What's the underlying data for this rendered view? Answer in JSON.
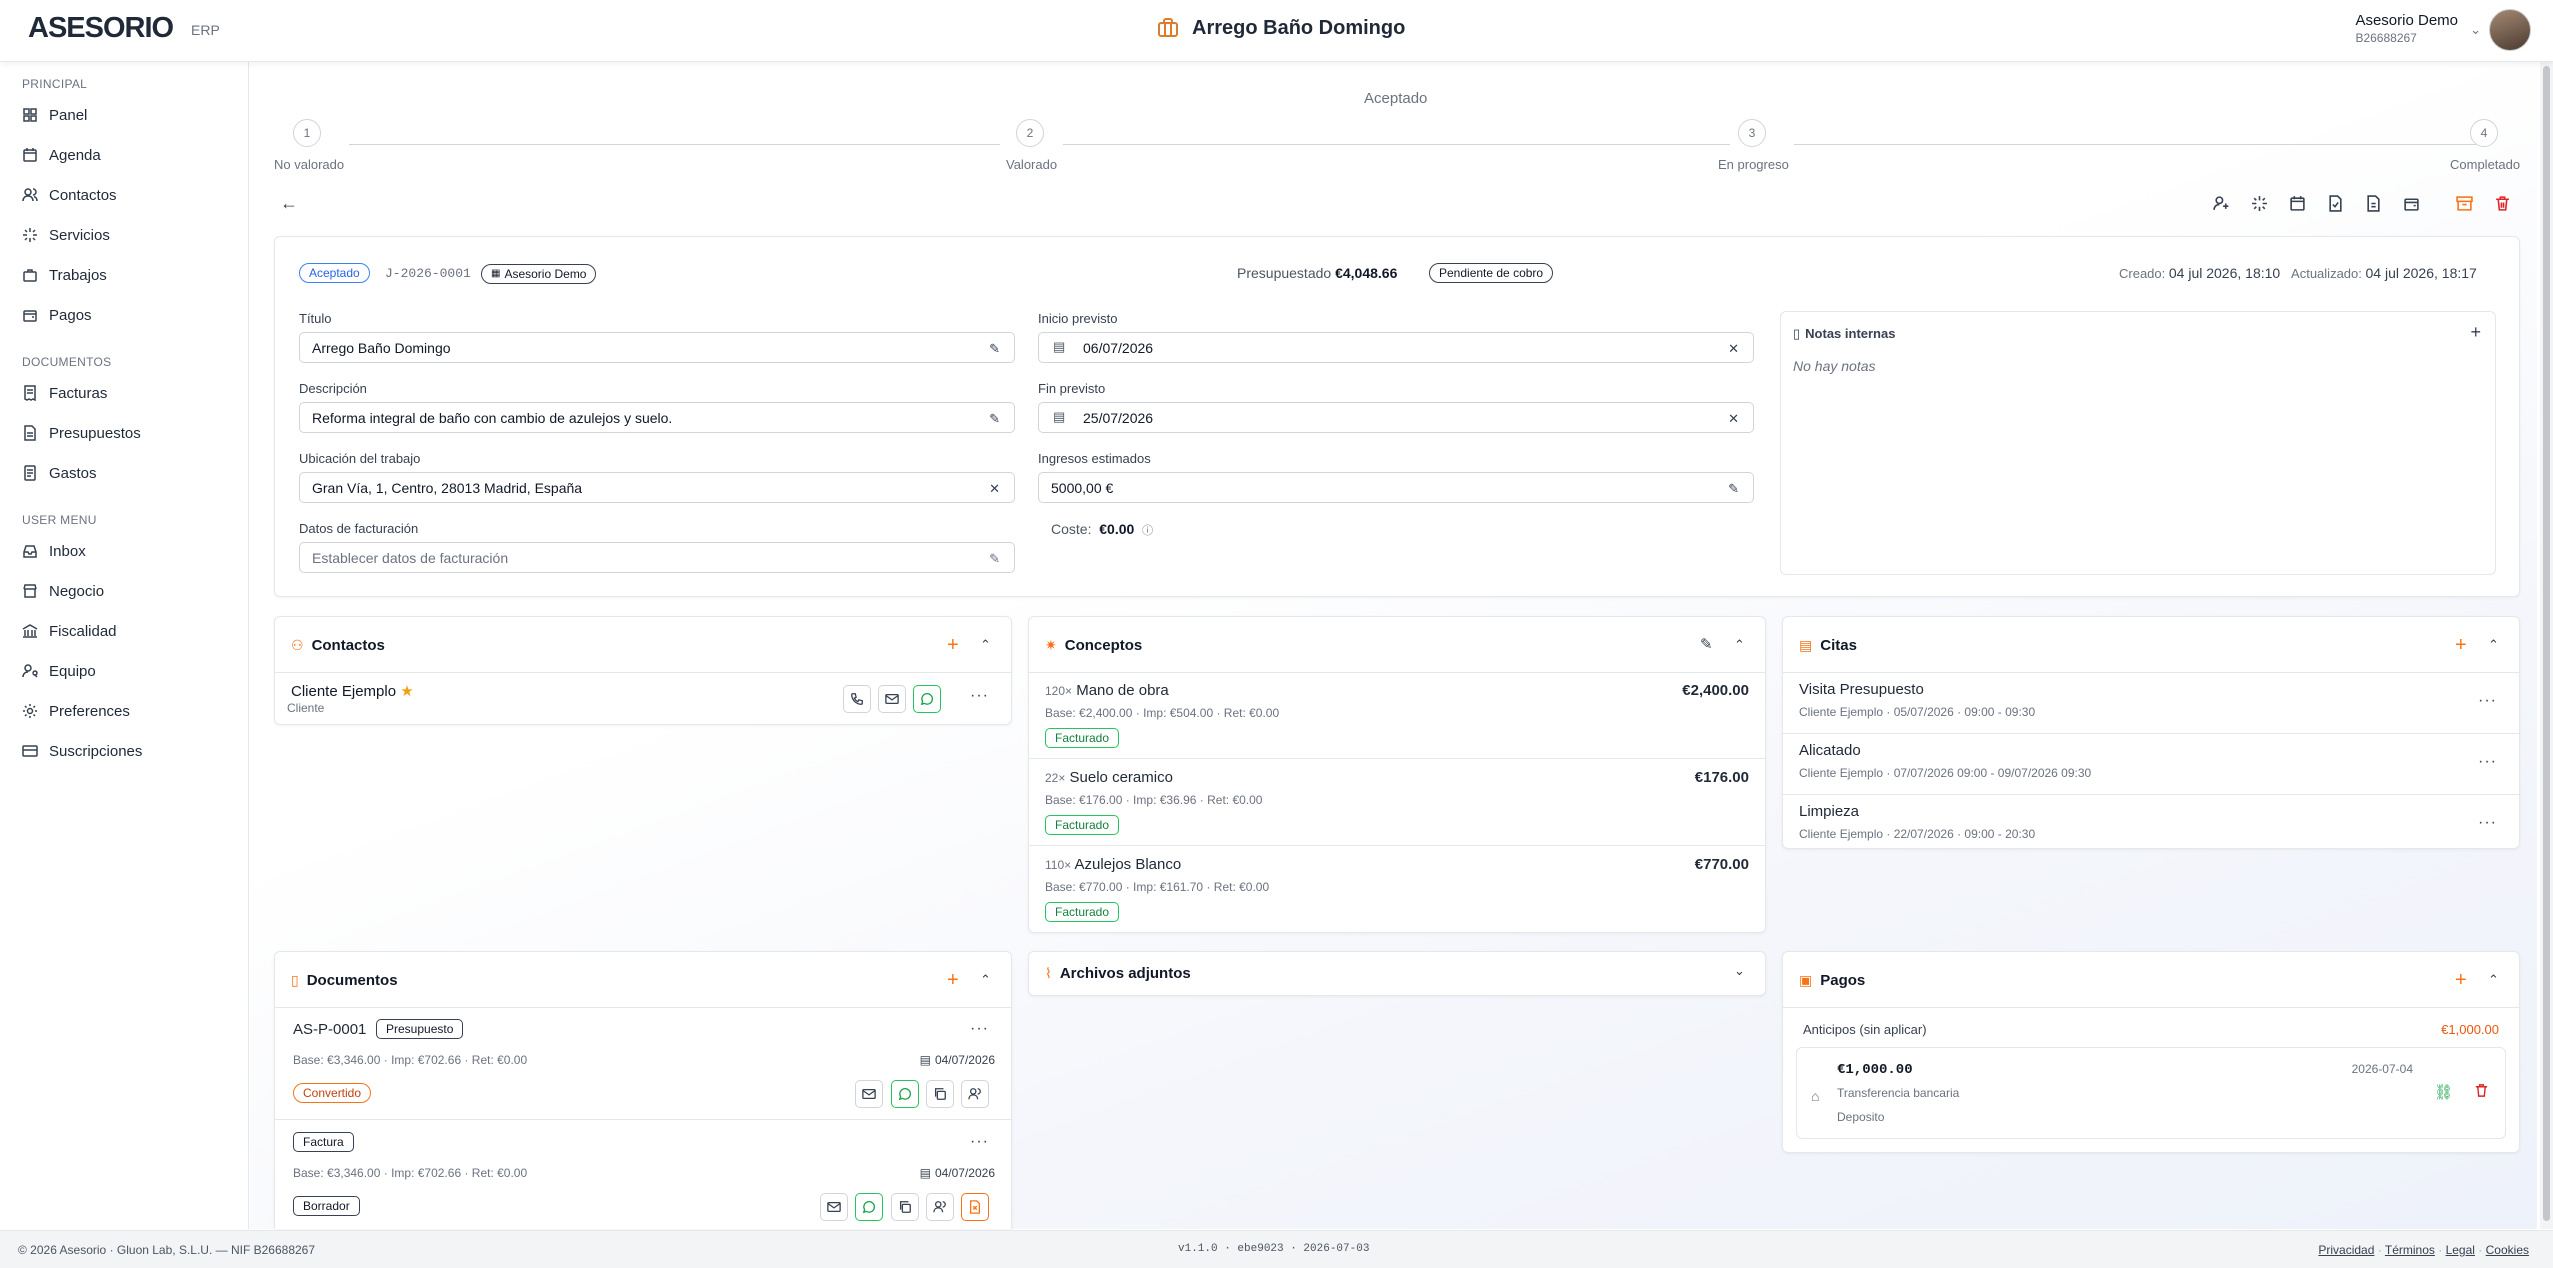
{
  "app": {
    "logo": "ASESORIO",
    "module": "ERP",
    "title": "Arrego Baño Domingo"
  },
  "user": {
    "name": "Asesorio Demo",
    "nif": "B26688267"
  },
  "sidebar": {
    "sections": [
      {
        "title": "PRINCIPAL",
        "items": [
          "Panel",
          "Agenda",
          "Contactos",
          "Servicios",
          "Trabajos",
          "Pagos"
        ]
      },
      {
        "title": "DOCUMENTOS",
        "items": [
          "Facturas",
          "Presupuestos",
          "Gastos"
        ]
      },
      {
        "title": "USER MENU",
        "items": [
          "Inbox",
          "Negocio",
          "Fiscalidad",
          "Equipo",
          "Preferences",
          "Suscripciones"
        ]
      }
    ]
  },
  "progress": {
    "current_label": "Aceptado",
    "steps": [
      {
        "num": "1",
        "label": "No valorado"
      },
      {
        "num": "2",
        "label": "Valorado"
      },
      {
        "num": "3",
        "label": "En progreso"
      },
      {
        "num": "4",
        "label": "Completado"
      }
    ]
  },
  "job": {
    "status": "Aceptado",
    "code": "J-2026-0001",
    "owner": "Asesorio Demo",
    "budgeted_label": "Presupuestado",
    "budgeted_value": "€4,048.66",
    "payment_status": "Pendiente de cobro",
    "created_label": "Creado:",
    "created_value": "04 jul 2026, 18:10",
    "updated_label": "Actualizado:",
    "updated_value": "04 jul 2026, 18:17"
  },
  "form": {
    "title_label": "Título",
    "title_value": "Arrego Baño Domingo",
    "desc_label": "Descripción",
    "desc_value": "Reforma integral de baño con cambio de azulejos y suelo.",
    "loc_label": "Ubicación del trabajo",
    "loc_value": "Gran Vía, 1, Centro, 28013 Madrid, España",
    "billing_label": "Datos de facturación",
    "billing_placeholder": "Establecer datos de facturación",
    "start_label": "Inicio previsto",
    "start_value": "06/07/2026",
    "end_label": "Fin previsto",
    "end_value": "25/07/2026",
    "income_label": "Ingresos estimados",
    "income_value": "5000,00 €",
    "cost_label": "Coste:",
    "cost_value": "€0.00"
  },
  "notes": {
    "title": "Notas internas",
    "empty": "No hay notas"
  },
  "contacts": {
    "title": "Contactos",
    "items": [
      {
        "name": "Cliente Ejemplo",
        "role": "Cliente"
      }
    ]
  },
  "concepts": {
    "title": "Conceptos",
    "items": [
      {
        "qty": "120×",
        "name": "Mano de obra",
        "amount": "€2,400.00",
        "detail": "Base: €2,400.00 · Imp: €504.00 · Ret: €0.00",
        "status": "Facturado"
      },
      {
        "qty": "22×",
        "name": "Suelo ceramico",
        "amount": "€176.00",
        "detail": "Base: €176.00 · Imp: €36.96 · Ret: €0.00",
        "status": "Facturado"
      },
      {
        "qty": "110×",
        "name": "Azulejos Blanco",
        "amount": "€770.00",
        "detail": "Base: €770.00 · Imp: €161.70 · Ret: €0.00",
        "status": "Facturado"
      }
    ]
  },
  "appointments": {
    "title": "Citas",
    "items": [
      {
        "title": "Visita Presupuesto",
        "detail": "Cliente Ejemplo · 05/07/2026 · 09:00 - 09:30"
      },
      {
        "title": "Alicatado",
        "detail": "Cliente Ejemplo · 07/07/2026 09:00 - 09/07/2026 09:30"
      },
      {
        "title": "Limpieza",
        "detail": "Cliente Ejemplo · 22/07/2026 · 09:00 - 20:30"
      }
    ]
  },
  "documents": {
    "title": "Documentos",
    "items": [
      {
        "code": "AS-P-0001",
        "type": "Presupuesto",
        "detail": "Base: €3,346.00 · Imp: €702.66 · Ret: €0.00",
        "date": "04/07/2026",
        "status": "Convertido"
      },
      {
        "code": "",
        "type": "Factura",
        "detail": "Base: €3,346.00 · Imp: €702.66 · Ret: €0.00",
        "date": "04/07/2026",
        "status": "Borrador"
      }
    ]
  },
  "attachments": {
    "title": "Archivos adjuntos"
  },
  "payments": {
    "title": "Pagos",
    "advance_label": "Anticipos (sin aplicar)",
    "advance_total": "€1,000.00",
    "item": {
      "amount": "€1,000.00",
      "date": "2026-07-04",
      "method": "Transferencia bancaria",
      "type": "Deposito"
    }
  },
  "footer": {
    "left": "© 2026 Asesorio · Gluon Lab, S.L.U. — NIF B26688267",
    "version": "v1.1.0 · ebe9023 · 2026-07-03",
    "links": [
      "Privacidad",
      "Términos",
      "Legal",
      "Cookies"
    ]
  },
  "colors": {
    "accent": "#f97316",
    "primary_blue": "#3b82f6",
    "success": "#22c55e",
    "danger": "#dc2626"
  }
}
